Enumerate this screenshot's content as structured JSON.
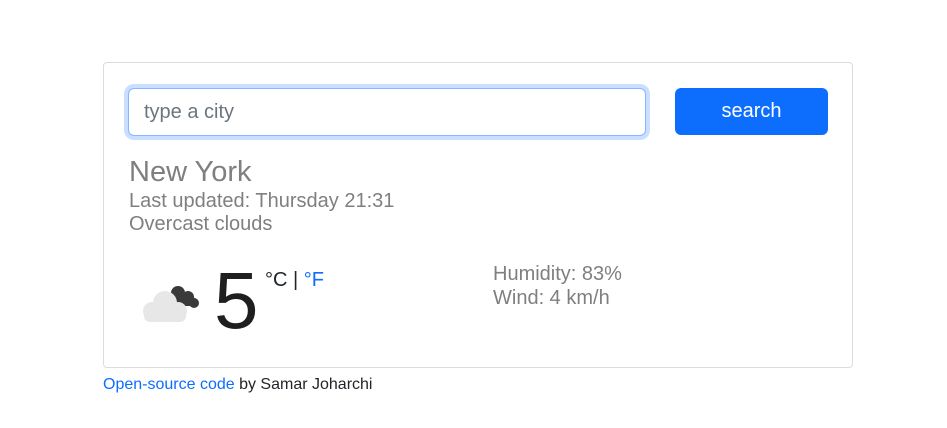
{
  "search": {
    "placeholder": "type a city",
    "value": "",
    "button_label": "search"
  },
  "weather": {
    "city": "New York",
    "last_updated": "Last updated: Thursday 21:31",
    "description": "Overcast clouds",
    "icon": "overcast-clouds-icon",
    "temperature": "5",
    "unit_c": "°C",
    "unit_separator": " | ",
    "unit_f": "°F",
    "humidity": "Humidity: 83%",
    "wind": "Wind: 4 km/h"
  },
  "footer": {
    "link_text": "Open-source code",
    "suffix": " by Samar Joharchi"
  },
  "colors": {
    "accent": "#0d6efd",
    "muted_text": "#7f7f7f",
    "card_border": "#dcdcdc"
  }
}
